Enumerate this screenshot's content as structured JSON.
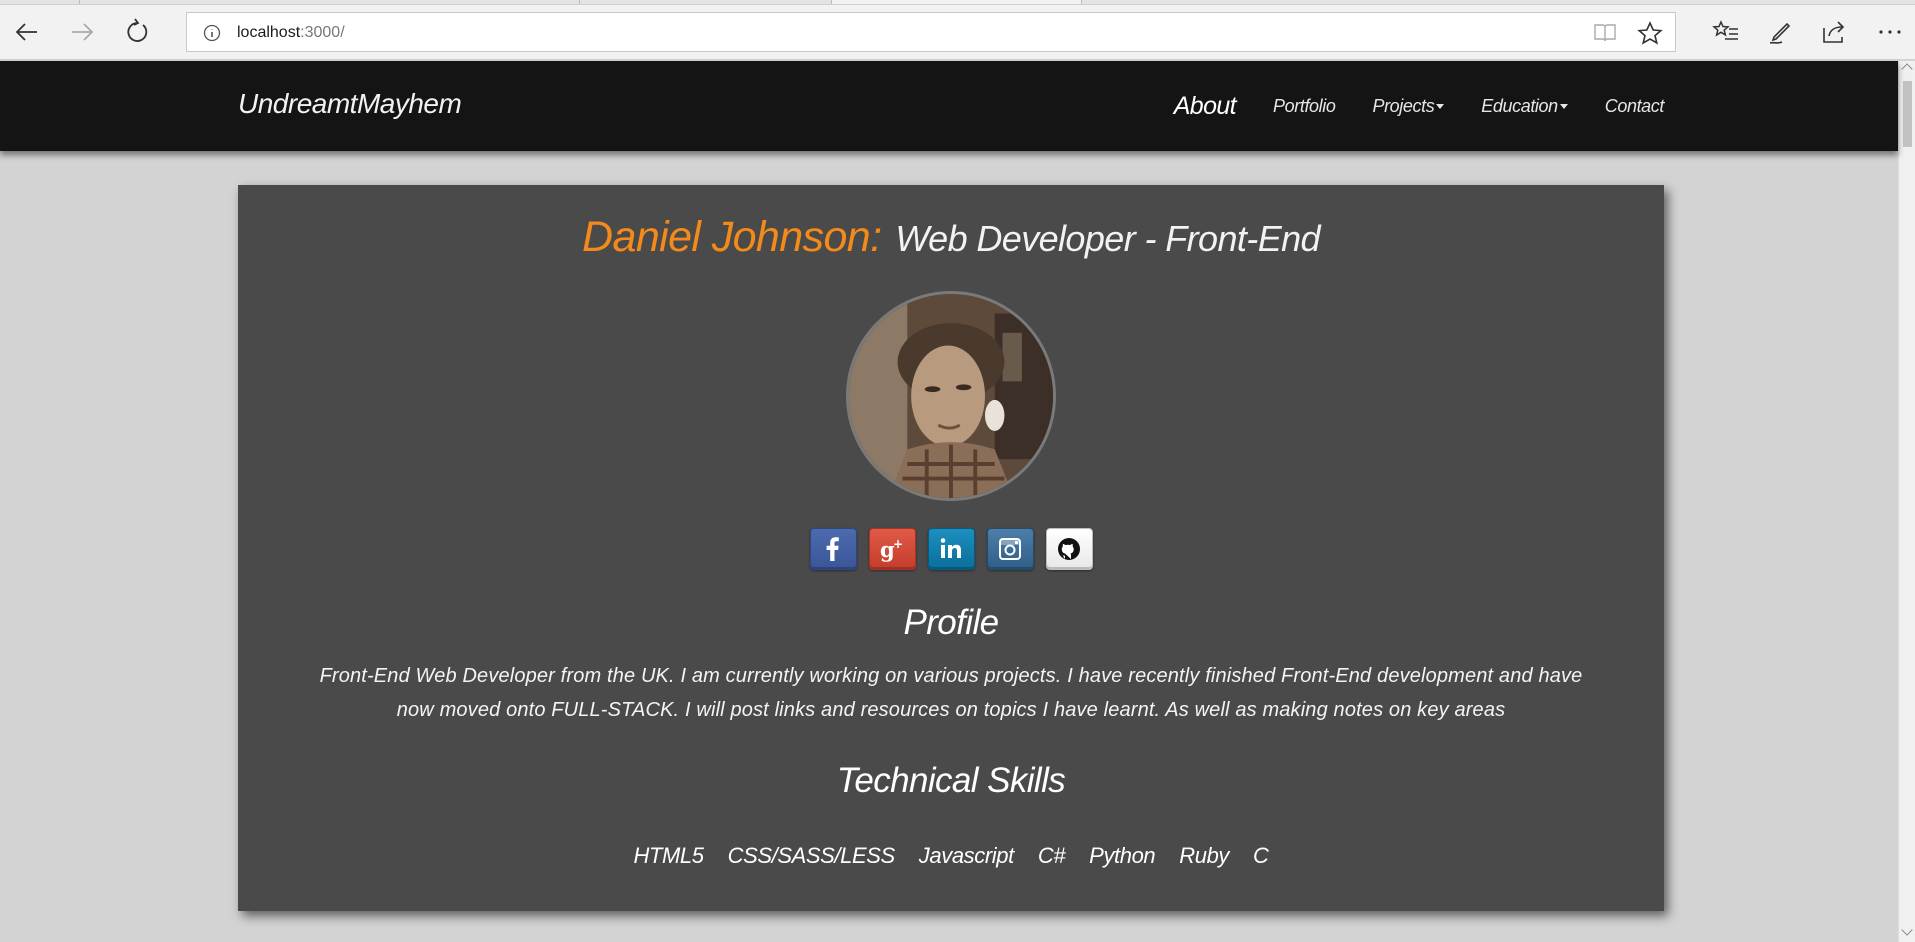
{
  "browser": {
    "address": {
      "host": "localhost",
      "port_path": ":3000/"
    },
    "icons": {
      "back": "back-arrow-icon",
      "forward": "forward-arrow-icon",
      "refresh": "refresh-icon",
      "site_info": "info-icon",
      "reading_view": "reading-view-icon",
      "favorite": "star-icon",
      "favorites_hub": "favorites-list-icon",
      "web_note": "pen-icon",
      "share": "share-icon",
      "more": "ellipsis-icon"
    }
  },
  "navbar": {
    "brand": "UndreamtMayhem",
    "links": [
      {
        "label": "About",
        "active": true,
        "dropdown": false
      },
      {
        "label": "Portfolio",
        "active": false,
        "dropdown": false
      },
      {
        "label": "Projects",
        "active": false,
        "dropdown": true
      },
      {
        "label": "Education",
        "active": false,
        "dropdown": true
      },
      {
        "label": "Contact",
        "active": false,
        "dropdown": false
      }
    ]
  },
  "hero": {
    "name": "Daniel Johnson:",
    "role": "Web Developer - Front-End",
    "avatar_icon": "profile-photo"
  },
  "socials": [
    {
      "id": "facebook",
      "icon": "facebook-icon",
      "color": "#3b5998"
    },
    {
      "id": "google-plus",
      "icon": "google-plus-icon",
      "color": "#d34836"
    },
    {
      "id": "linkedin",
      "icon": "linkedin-icon",
      "color": "#0e76a8"
    },
    {
      "id": "instagram",
      "icon": "instagram-icon",
      "color": "#3f729b"
    },
    {
      "id": "github",
      "icon": "github-icon",
      "color": "#ffffff"
    }
  ],
  "profile": {
    "heading": "Profile",
    "bio_line1": "Front-End Web Developer from the UK. I am currently working on various projects. I have recently finished Front-End development and have",
    "bio_line2": "now moved onto FULL-STACK. I will post links and resources on topics I have learnt. As well as making notes on key areas"
  },
  "skills": {
    "heading": "Technical Skills",
    "items": [
      "HTML5",
      "CSS/SASS/LESS",
      "Javascript",
      "C#",
      "Python",
      "Ruby",
      "C"
    ]
  },
  "colors": {
    "accent": "#f48a1a",
    "navbar_bg": "#141414",
    "card_bg": "#4a4a4a",
    "page_bg": "#d3d3d3"
  }
}
